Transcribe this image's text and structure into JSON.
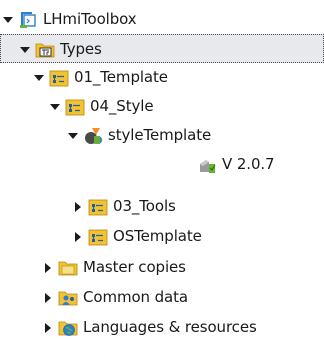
{
  "tree": {
    "root": {
      "label": "LHmiToolbox",
      "expanded": true,
      "icon": "hmi-device-icon"
    },
    "types": {
      "label": "Types",
      "expanded": true,
      "selected": true,
      "icon": "types-folder-icon"
    },
    "template": {
      "label": "01_Template",
      "expanded": true,
      "icon": "library-folder-icon"
    },
    "style": {
      "label": "04_Style",
      "expanded": true,
      "icon": "library-folder-icon"
    },
    "style_template": {
      "label": "styleTemplate",
      "expanded": true,
      "icon": "style-type-icon"
    },
    "version": {
      "label": "V 2.0.7",
      "icon": "version-released-icon"
    },
    "tools": {
      "label": "03_Tools",
      "expanded": false,
      "icon": "library-folder-icon"
    },
    "os_template": {
      "label": "OSTemplate",
      "expanded": false,
      "icon": "library-folder-icon"
    },
    "master_copies": {
      "label": "Master copies",
      "expanded": false,
      "icon": "master-copies-folder-icon"
    },
    "common_data": {
      "label": "Common data",
      "expanded": false,
      "icon": "common-data-folder-icon"
    },
    "languages": {
      "label": "Languages & resources",
      "expanded": false,
      "icon": "languages-folder-icon"
    }
  },
  "colors": {
    "selection_bg": "#e7e9ec",
    "folder_yellow": "#f2c230",
    "accent_green": "#6ab42d",
    "accent_blue": "#2a7fd0"
  }
}
